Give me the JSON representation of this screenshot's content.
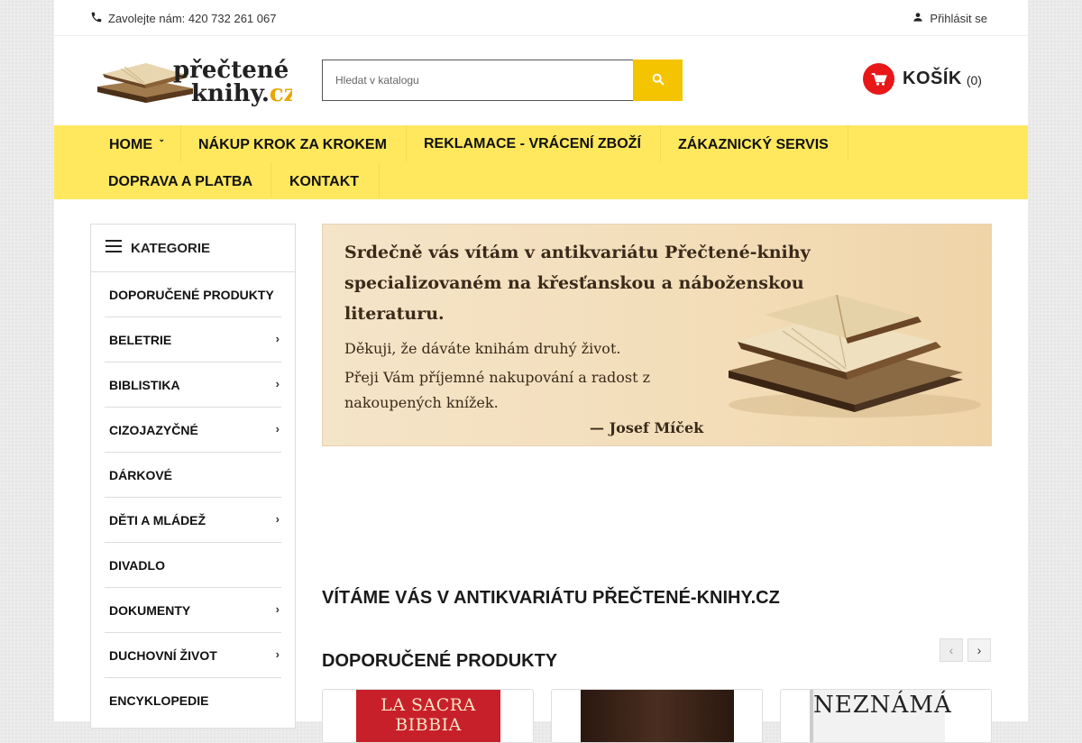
{
  "topbar": {
    "contact": "Zavolejte nám: 420 732 261 067",
    "login": "Přihlásit se"
  },
  "header": {
    "logo_text_line1": "přečtené",
    "logo_text_line2": "knihy.cz",
    "search_placeholder": "Hledat v katalogu",
    "cart_label": "KOŠÍK",
    "cart_count": "(0)"
  },
  "nav": {
    "items": [
      {
        "label": "HOME"
      },
      {
        "label": "NÁKUP KROK ZA KROKEM"
      },
      {
        "label": "REKLAMACE - VRÁCENÍ ZBOŽÍ"
      },
      {
        "label": "ZÁKAZNICKÝ SERVIS"
      },
      {
        "label": "DOPRAVA A PLATBA"
      },
      {
        "label": "KONTAKT"
      }
    ]
  },
  "sidebar": {
    "title": "KATEGORIE",
    "items": [
      {
        "label": "DOPORUČENÉ PRODUKTY",
        "has_sub": false
      },
      {
        "label": "BELETRIE",
        "has_sub": true
      },
      {
        "label": "BIBLISTIKA",
        "has_sub": true
      },
      {
        "label": "CIZOJAZYČNÉ",
        "has_sub": true
      },
      {
        "label": "DÁRKOVÉ",
        "has_sub": false
      },
      {
        "label": "DĚTI A MLÁDEŽ",
        "has_sub": true
      },
      {
        "label": "DIVADLO",
        "has_sub": false
      },
      {
        "label": "DOKUMENTY",
        "has_sub": true
      },
      {
        "label": "DUCHOVNÍ ŽIVOT",
        "has_sub": true
      },
      {
        "label": "ENCYKLOPEDIE",
        "has_sub": false
      }
    ]
  },
  "banner": {
    "line1": "Srdečně vás vítám v antikvariátu Přečtené-knihy",
    "line2": "specializovaném na křesťanskou a náboženskou",
    "line3": "literaturu.",
    "line4": "Děkuji, že dáváte knihám druhý život.",
    "line5": "Přeji Vám příjemné nakupování a radost z",
    "line6": "nakoupených knížek.",
    "signature": "— Josef Míček"
  },
  "main": {
    "welcome": "VÍTÁME VÁS V ANTIKVARIÁTU PŘEČTENÉ-KNIHY.CZ",
    "featured": "DOPORUČENÉ PRODUKTY"
  },
  "products": [
    {
      "cover_text": "LA SACRA BIBBIA",
      "cover_color": "#c8202a"
    },
    {
      "cover_text": "",
      "cover_color": "#3a2418"
    },
    {
      "cover_text": "NEZNÁMÁ",
      "cover_color": "#f2f2f2"
    }
  ],
  "colors": {
    "accent_yellow": "#f5c400",
    "nav_yellow": "#ffe85e",
    "cart_red": "#e81818"
  }
}
